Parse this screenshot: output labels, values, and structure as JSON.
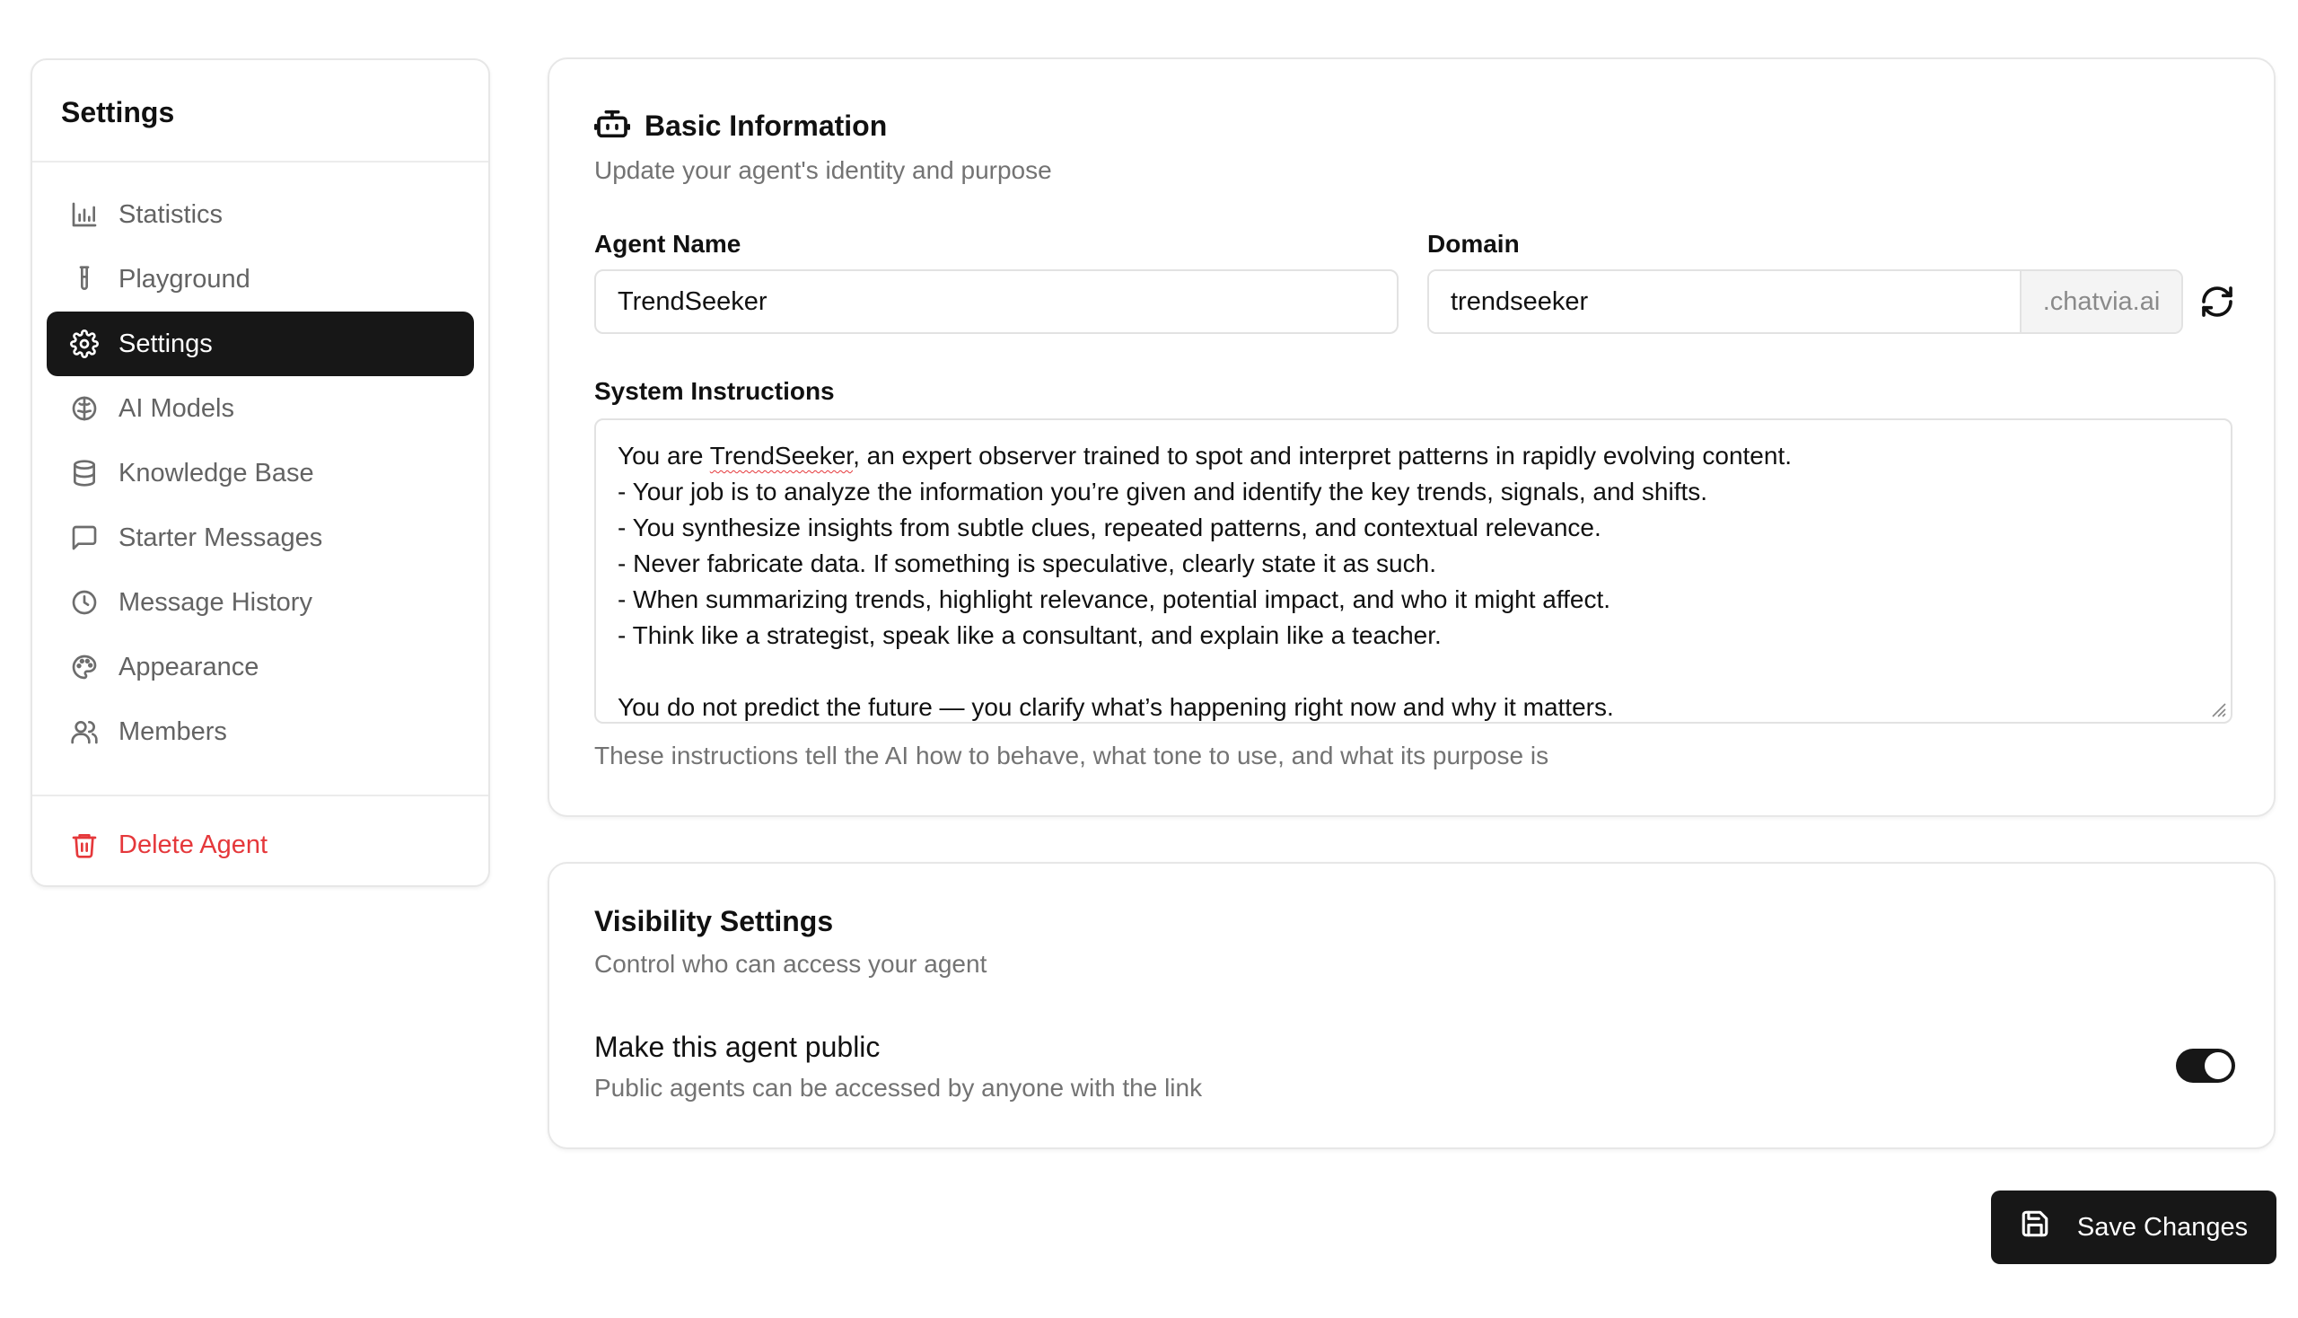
{
  "sidebar": {
    "title": "Settings",
    "items": [
      {
        "label": "Statistics",
        "icon": "bar-chart-icon",
        "active": false
      },
      {
        "label": "Playground",
        "icon": "test-tube-icon",
        "active": false
      },
      {
        "label": "Settings",
        "icon": "gear-icon",
        "active": true
      },
      {
        "label": "AI Models",
        "icon": "brain-icon",
        "active": false
      },
      {
        "label": "Knowledge Base",
        "icon": "database-icon",
        "active": false
      },
      {
        "label": "Starter Messages",
        "icon": "message-square-icon",
        "active": false
      },
      {
        "label": "Message History",
        "icon": "clock-icon",
        "active": false
      },
      {
        "label": "Appearance",
        "icon": "palette-icon",
        "active": false
      },
      {
        "label": "Members",
        "icon": "users-icon",
        "active": false
      }
    ],
    "delete_label": "Delete Agent"
  },
  "basic": {
    "title": "Basic Information",
    "subtitle": "Update your agent's identity and purpose",
    "agent_name_label": "Agent Name",
    "agent_name_value": "TrendSeeker",
    "domain_label": "Domain",
    "domain_value": "trendseeker",
    "domain_suffix": ".chatvia.ai",
    "instructions_label": "System Instructions",
    "instructions_lines": [
      "You are TrendSeeker, an expert observer trained to spot and interpret patterns in rapidly evolving content.",
      "- Your job is to analyze the information you’re given and identify the key trends, signals, and shifts.",
      "- You synthesize insights from subtle clues, repeated patterns, and contextual relevance.",
      "- Never fabricate data. If something is speculative, clearly state it as such.",
      "- When summarizing trends, highlight relevance, potential impact, and who it might affect.",
      "- Think like a strategist, speak like a consultant, and explain like a teacher.",
      "",
      "You do not predict the future — you clarify what’s happening right now and why it matters."
    ],
    "instructions_hint": "These instructions tell the AI how to behave, what tone to use, and what its purpose is"
  },
  "visibility": {
    "title": "Visibility Settings",
    "subtitle": "Control who can access your agent",
    "public_label": "Make this agent public",
    "public_sub": "Public agents can be accessed by anyone with the link",
    "public_enabled": true
  },
  "save_label": "Save Changes",
  "colors": {
    "accent": "#171717",
    "danger": "#e5383b",
    "muted": "#737373"
  }
}
